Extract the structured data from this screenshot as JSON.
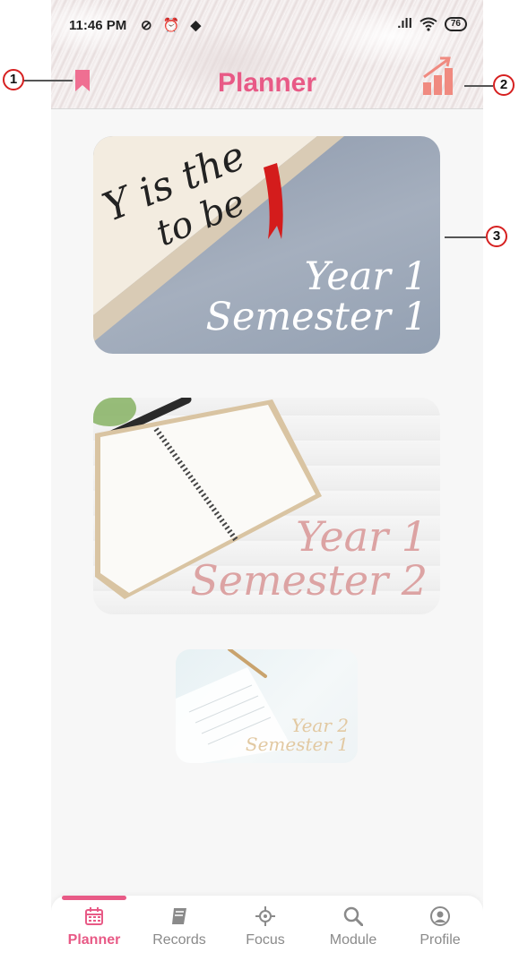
{
  "status_bar": {
    "time": "11:46 PM",
    "left_icons": "⊘ ⏰ ◆",
    "signal": ".ıll",
    "wifi": "wifi",
    "battery": "76"
  },
  "header": {
    "title": "Planner",
    "bookmark_icon": "bookmark-icon",
    "stats_icon": "bar-chart-trend-icon"
  },
  "cards": [
    {
      "line1": "Year 1",
      "line2": "Semester 1"
    },
    {
      "line1": "Year 1",
      "line2": "Semester 2"
    },
    {
      "line1": "Year 2",
      "line2": "Semester 1"
    }
  ],
  "nav": {
    "items": [
      {
        "label": "Planner",
        "icon": "calendar-icon",
        "active": true
      },
      {
        "label": "Records",
        "icon": "book-icon",
        "active": false
      },
      {
        "label": "Focus",
        "icon": "crosshair-icon",
        "active": false
      },
      {
        "label": "Module",
        "icon": "search-icon",
        "active": false
      },
      {
        "label": "Profile",
        "icon": "user-circle-icon",
        "active": false
      }
    ]
  },
  "callouts": [
    "1",
    "2",
    "3"
  ],
  "colors": {
    "accent": "#e85a86",
    "inactive": "#8a8a8a",
    "callout_ring": "#d62020"
  }
}
